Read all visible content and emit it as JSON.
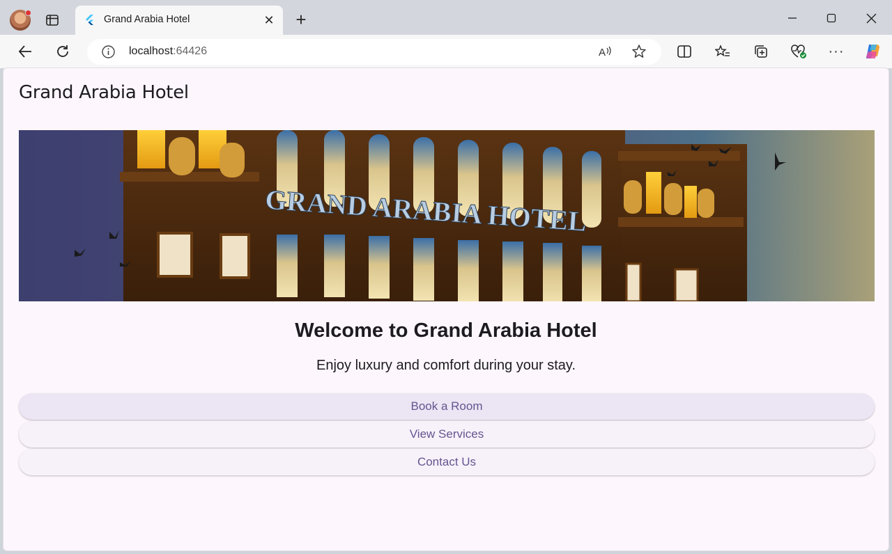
{
  "browser": {
    "tab_title": "Grand Arabia Hotel",
    "tab_close_glyph": "✕",
    "new_tab_glyph": "+",
    "url_host": "localhost",
    "url_port": ":64426",
    "minimize_glyph": "—",
    "close_glyph": "✕",
    "more_glyph": "···"
  },
  "app": {
    "title": "Grand Arabia Hotel",
    "hero_sign": "GRAND ARABIA HOTEL",
    "welcome": "Welcome to Grand Arabia Hotel",
    "tagline": "Enjoy luxury and comfort during your stay.",
    "buttons": [
      {
        "label": "Book a Room"
      },
      {
        "label": "View Services"
      },
      {
        "label": "Contact Us"
      }
    ]
  },
  "colors": {
    "page_background": "#fdf7fd",
    "button_background": "#f7f2fa",
    "button_text": "#65558f",
    "title_text": "#1d1b20"
  },
  "icons": [
    "profile-avatar",
    "tab-actions-icon",
    "flutter-favicon",
    "back-icon",
    "refresh-icon",
    "info-icon",
    "read-aloud-icon",
    "favorite-star-icon",
    "split-screen-icon",
    "favorites-icon",
    "collections-icon",
    "browser-essentials-icon",
    "more-icon",
    "copilot-icon"
  ]
}
